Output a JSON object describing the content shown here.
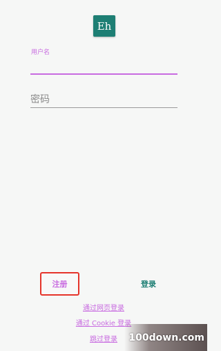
{
  "logo": {
    "text": "Eh"
  },
  "username": {
    "label": "用户名",
    "value": ""
  },
  "password": {
    "placeholder": "密码"
  },
  "actions": {
    "register": "注册",
    "login": "登录"
  },
  "links": {
    "web_login": "通过网页登录",
    "cookie_login": "通过 Cookie 登录",
    "skip_login": "跳过登录"
  },
  "watermark": {
    "text": "100down.com"
  },
  "colors": {
    "accent": "#c86be0",
    "brand": "#1e7f74",
    "highlight_border": "#e5332a"
  }
}
